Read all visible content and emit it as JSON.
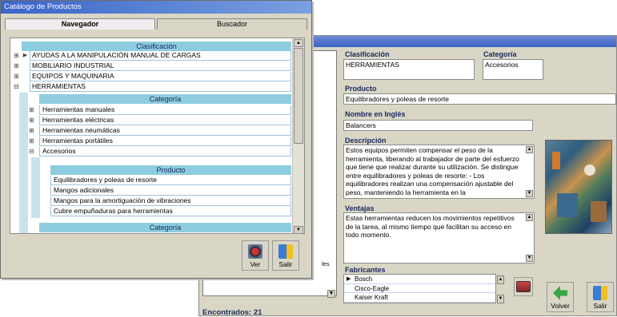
{
  "catalog": {
    "title": "Catálogo de Productos",
    "tabs": [
      "Navegador",
      "Buscador"
    ],
    "headers": {
      "clasificacion": "Clasificación",
      "categoria": "Categoría",
      "producto": "Producto",
      "categoria2": "Categoría"
    },
    "clasificaciones": [
      "AYUDAS A LA MANIPULACIÓN MANUAL DE CARGAS",
      "MOBILIARIO INDUSTRIAL",
      "EQUIPOS Y MAQUINARIA",
      "HERRAMIENTAS"
    ],
    "categorias": [
      "Herramientas manuales",
      "Herramientas eléctricas",
      "Herramientas neumáticas",
      "Herramientas portátiles",
      "Accesorios"
    ],
    "productos": [
      "Equilibradores y poleas de resorte",
      "Mangos adicionales",
      "Mangos para la amortiguación de vibraciones",
      "Cubre empuñaduras para herramientas"
    ],
    "buttons": {
      "ver": "Ver",
      "salir": "Salir"
    }
  },
  "detail": {
    "fields": {
      "clasificacion_label": "Clasificación",
      "clasificacion": "HERRAMIENTAS",
      "categoria_label": "Categoría",
      "categoria": "Accesorios",
      "producto_label": "Producto",
      "producto": "Equilibradores y poleas de resorte",
      "ingles_label": "Nombre en Inglés",
      "ingles": "Balancers",
      "descripcion_label": "Descripción",
      "descripcion": "Estos equipos permiten compensar el peso de la herramienta, liberando al trabajador de parte del esfuerzo que tiene que realizar durante su utilización. Se distingue entre equilibradores y poleas de resorte: - Los equilibradores realizan una compensación ajustable del peso, manteniendo la herramienta en la",
      "ventajas_label": "Ventajas",
      "ventajas": "Estas herramientas reducen los movimientos repetitivos de la tarea, al mismo tiempo que facilitan su acceso en todo momento.",
      "fabricantes_label": "Fabricantes"
    },
    "fabricantes": [
      "Bosch",
      "Cisco-Eagle",
      "Kaiser Kraft"
    ],
    "left_fragment": "les",
    "found": "Encontrados: 21",
    "buttons": {
      "volver": "Volver",
      "salir": "Salir"
    }
  }
}
